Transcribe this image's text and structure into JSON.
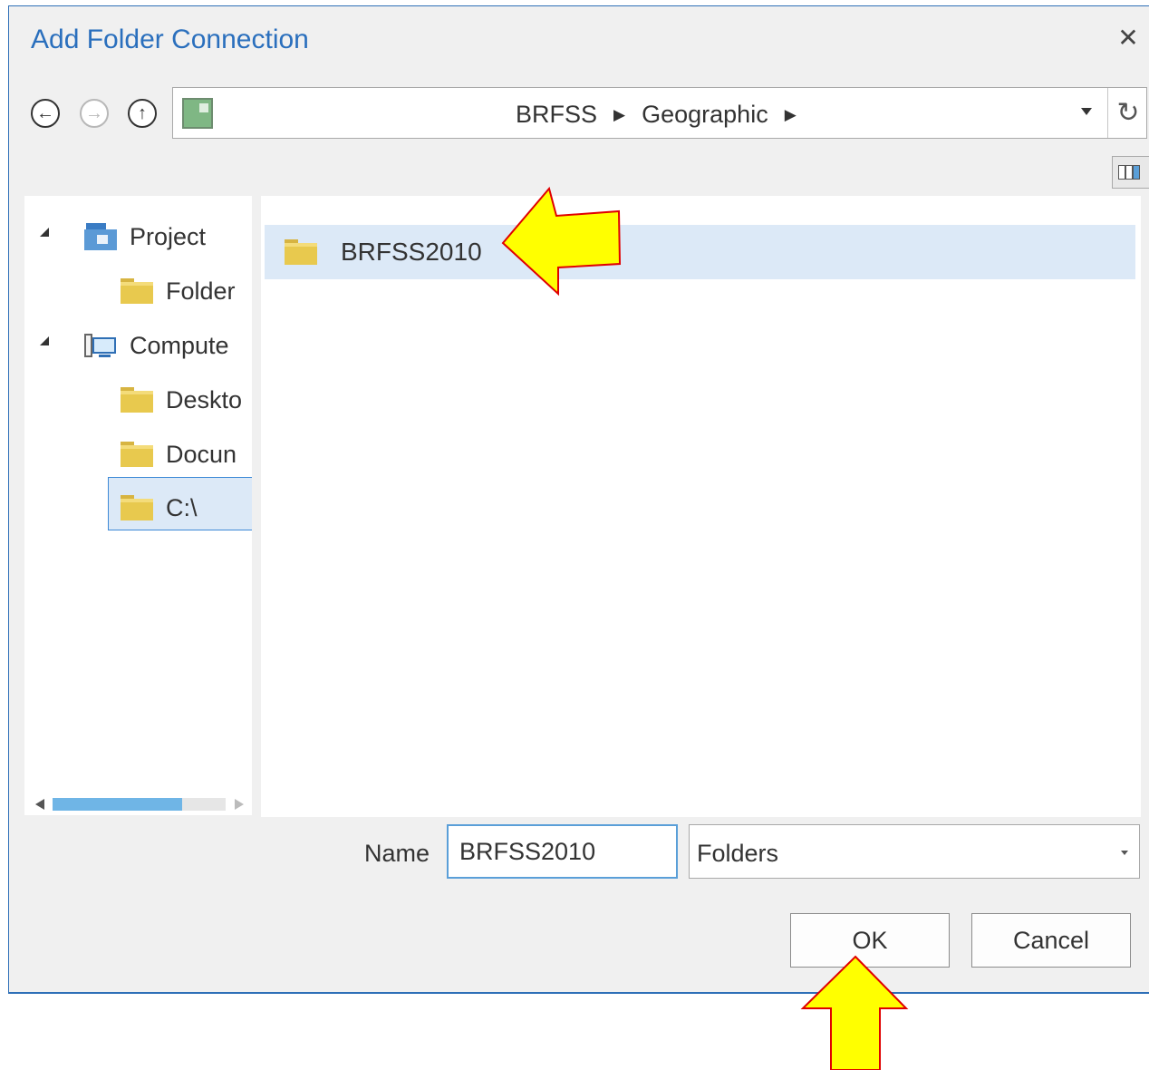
{
  "dialog": {
    "title": "Add Folder Connection",
    "close_icon": "close-icon",
    "colors": {
      "accent": "#2a6fbd",
      "selection": "#dce9f7",
      "callout_fill": "#ffff00",
      "callout_stroke": "#e00000"
    }
  },
  "toolbar": {
    "back_icon": "back-arrow-icon",
    "forward_icon": "forward-arrow-icon",
    "up_icon": "up-arrow-icon",
    "breadcrumbs": [
      "BRFSS",
      "Geographic"
    ],
    "refresh_icon": "refresh-icon",
    "view_icon": "view-options-icon"
  },
  "tree": {
    "items": [
      {
        "label": "Project",
        "icon": "project-icon"
      },
      {
        "label": "Folder",
        "icon": "folder-shortcut-icon"
      },
      {
        "label": "Compute",
        "icon": "computer-icon"
      },
      {
        "label": "Deskto",
        "icon": "folder-icon"
      },
      {
        "label": "Docun",
        "icon": "folder-icon"
      },
      {
        "label": "C:\\",
        "icon": "folder-icon",
        "selected": true
      }
    ]
  },
  "content": {
    "items": [
      {
        "label": "BRFSS2010",
        "icon": "folder-icon",
        "selected": true
      }
    ]
  },
  "footer": {
    "name_label": "Name",
    "name_value": "BRFSS2010",
    "type_value": "Folders",
    "ok_label": "OK",
    "cancel_label": "Cancel"
  }
}
